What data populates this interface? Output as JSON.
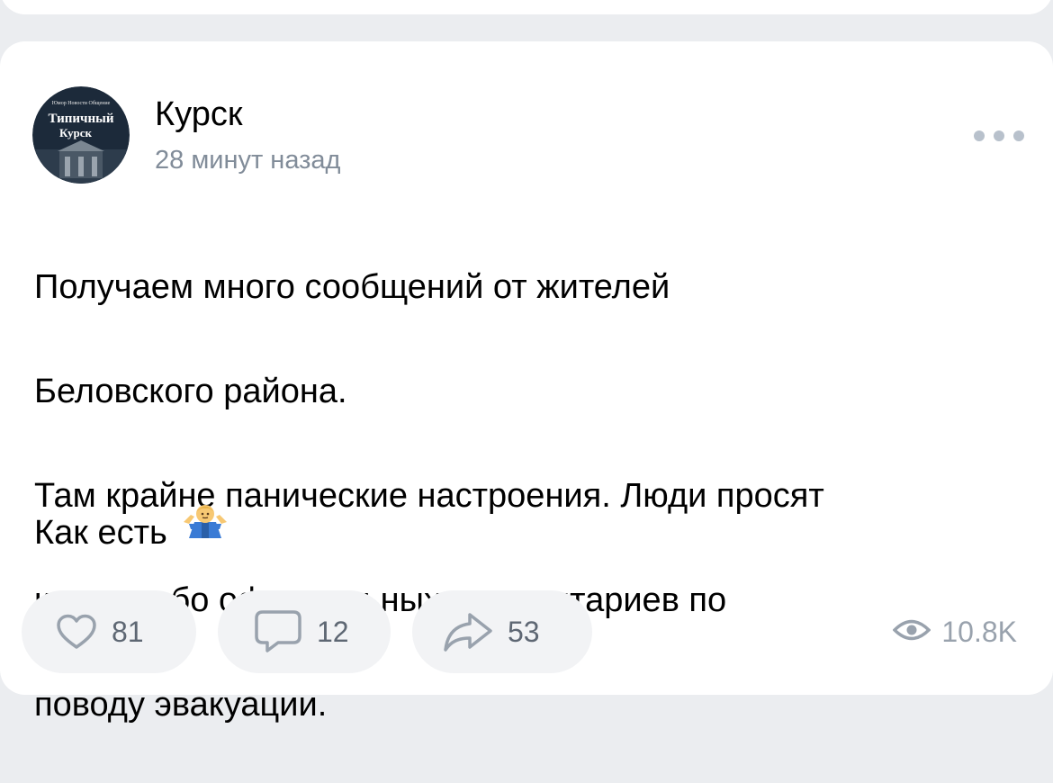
{
  "post": {
    "author": "Курск",
    "time": "28 минут назад",
    "body_lines": [
      "Получаем много сообщений от жителей",
      "Беловского района.",
      "Там крайне панические настроения. Люди просят",
      "каких-либо официальных комментариев по",
      "поводу эвакуации."
    ],
    "footer_text": "Как есть",
    "emoji": "person-shrugging-emoji"
  },
  "avatar": {
    "title_line1": "Типичный",
    "title_line2": "Курск",
    "tagline": "Юмор Новости Общение"
  },
  "actions": {
    "likes": "81",
    "comments": "12",
    "shares": "53",
    "views": "10.8K"
  },
  "colors": {
    "background": "#ebedf0",
    "card": "#ffffff",
    "pill": "#f2f3f5",
    "secondary_text": "#818c99",
    "icon": "#99a2ad"
  }
}
